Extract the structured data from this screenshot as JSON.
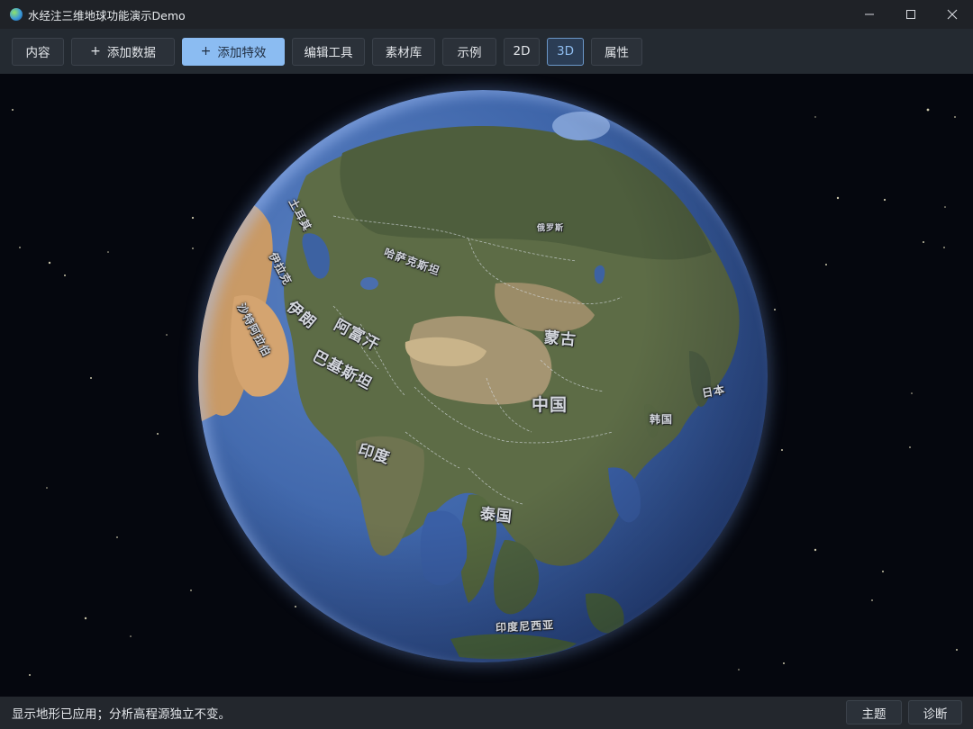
{
  "window": {
    "title": "水经注三维地球功能演示Demo",
    "icon": "globe-app-icon",
    "controls": [
      "minimize-icon",
      "maximize-icon",
      "close-icon"
    ]
  },
  "toolbar": {
    "content": "内容",
    "add_data": "添加数据",
    "add_effect": "添加特效",
    "edit_tools": "编辑工具",
    "material_lib": "素材库",
    "examples": "示例",
    "mode_2d": "2D",
    "mode_3d": "3D",
    "properties": "属性",
    "plus": "+"
  },
  "map": {
    "labels": {
      "kazakhstan": "哈萨克斯坦",
      "mongolia": "蒙古",
      "china": "中国",
      "afghanistan": "阿富汗",
      "pakistan": "巴基斯坦",
      "iran": "伊朗",
      "india": "印度",
      "thailand": "泰国",
      "korea": "韩国",
      "japan": "日本",
      "indonesia": "印度尼西亚",
      "saudi": "沙特阿拉伯",
      "iraq": "伊拉克",
      "turkey": "土耳其",
      "russia": "俄罗斯"
    }
  },
  "status": {
    "message": "显示地形已应用；分析高程源独立不变。",
    "theme": "主题",
    "diagnose": "诊断"
  },
  "colors": {
    "primary_button": "#8bbcf2",
    "active_button": "#6b97c8",
    "toolbar_bg": "#242a31",
    "space_bg": "#05070e"
  }
}
